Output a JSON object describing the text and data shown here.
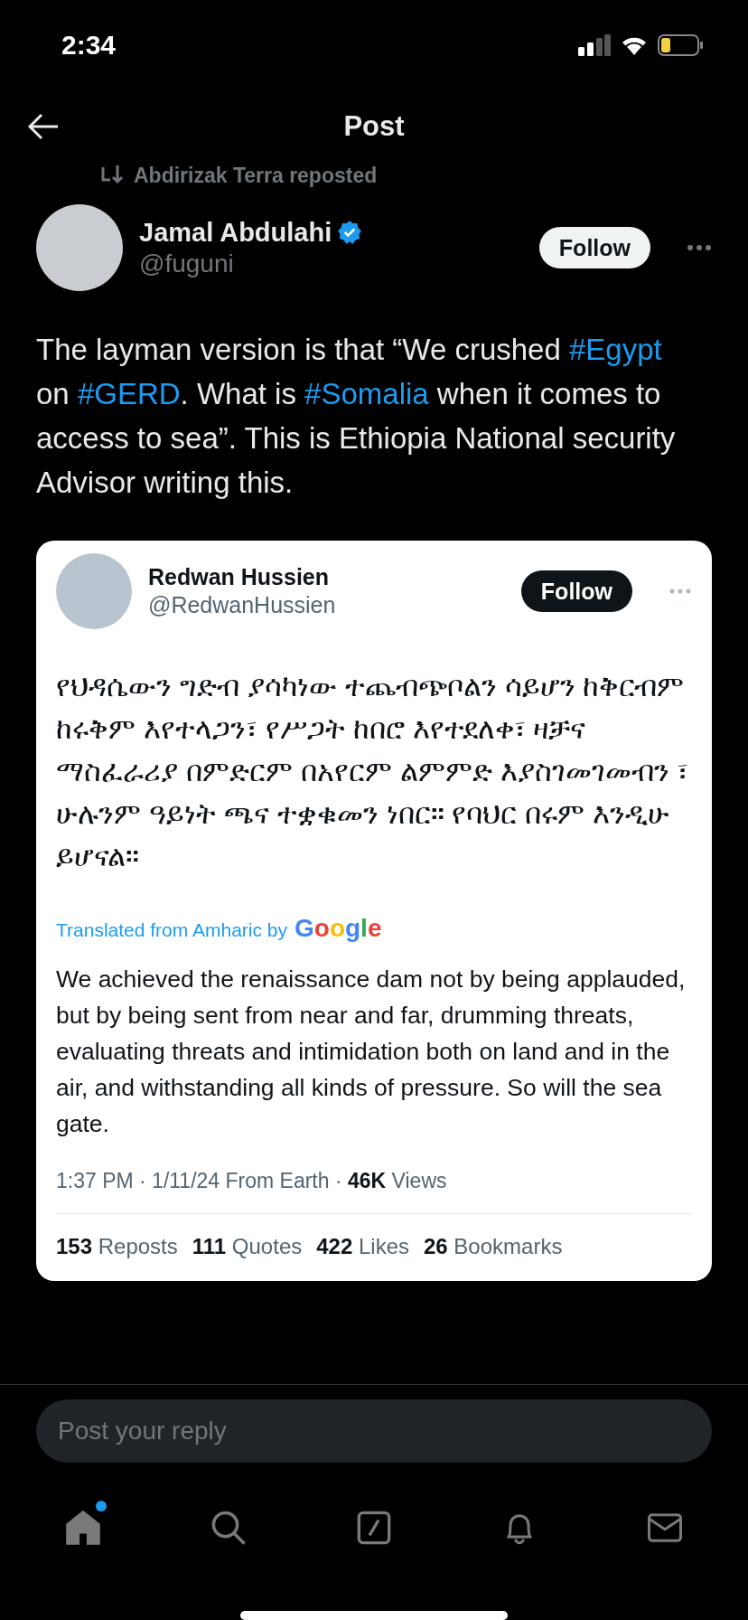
{
  "status_bar": {
    "time": "2:34"
  },
  "header": {
    "title": "Post"
  },
  "repost_note": "Abdirizak Terra reposted",
  "author": {
    "name": "Jamal Abdulahi",
    "handle": "@fuguni",
    "verified": true,
    "follow": "Follow"
  },
  "body": [
    {
      "kind": "text",
      "text": "The layman version is that “We crushed "
    },
    {
      "kind": "hashtag",
      "text": "#Egypt"
    },
    {
      "kind": "text",
      "text": " on "
    },
    {
      "kind": "hashtag",
      "text": "#GERD"
    },
    {
      "kind": "text",
      "text": ". What is "
    },
    {
      "kind": "hashtag",
      "text": "#Somalia"
    },
    {
      "kind": "text",
      "text": " when it comes to access to sea”. This is Ethiopia National security Advisor writing this."
    }
  ],
  "embedded": {
    "name": "Redwan Hussien",
    "handle": "@RedwanHussien",
    "follow": "Follow",
    "original_text": "የህዳሴውን ግድብ ያሳካነው ተጨብጭቦልን ሳይሆን ከቅርብም ከሩቅም እየተላጋን፣ የሥጋት ከበሮ እየተደለቀ፣  ዛቻና ማስፈራሪያ በምድርም በአየርም ልምምድ እያስገመገመብን ፣ ሁሉንም ዓይነት ጫና ተቋቁመን ነበር። የባህር በሩም እንዲሁ ይሆናል።",
    "translated_label": "Translated from Amharic by",
    "translator": "Google",
    "translation": "We achieved the renaissance dam not by being applauded, but by being sent from near and far, drumming threats, evaluating threats and intimidation both on land and in the air, and withstanding all kinds of pressure. So will the sea gate.",
    "meta": "1:37 PM · 1/11/24 From Earth · ",
    "views_count": "46K",
    "views_label": "Views",
    "stats": [
      {
        "count": "153",
        "label": "Reposts"
      },
      {
        "count": "111",
        "label": "Quotes"
      },
      {
        "count": "422",
        "label": "Likes"
      },
      {
        "count": "26",
        "label": "Bookmarks"
      }
    ]
  },
  "reply": {
    "placeholder": "Post your reply"
  },
  "nav": [
    {
      "kind": "home",
      "selected": true,
      "badge": true
    },
    {
      "kind": "search",
      "selected": false,
      "badge": false
    },
    {
      "kind": "grok",
      "selected": false,
      "badge": false
    },
    {
      "kind": "bell",
      "selected": false,
      "badge": false
    },
    {
      "kind": "mail",
      "selected": false,
      "badge": false
    }
  ]
}
